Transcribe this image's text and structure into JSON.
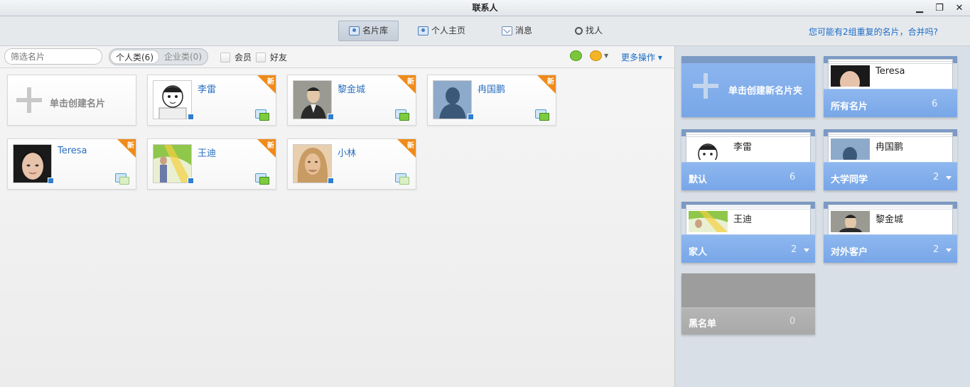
{
  "window": {
    "title": "联系人",
    "minimize": "▁",
    "restore": "❐",
    "close": "✕"
  },
  "nav": {
    "tabs": [
      {
        "label": "名片库",
        "icon": "card-library-icon",
        "active": true
      },
      {
        "label": "个人主页",
        "icon": "profile-icon",
        "active": false
      },
      {
        "label": "消息",
        "icon": "mail-icon",
        "active": false
      },
      {
        "label": "找人",
        "icon": "search-icon",
        "active": false
      }
    ],
    "merge_prompt": "您可能有2组重复的名片，合并吗?"
  },
  "toolbar": {
    "filter_placeholder": "筛选名片",
    "segments": [
      {
        "label": "个人类(6)",
        "selected": true
      },
      {
        "label": "企业类(0)",
        "selected": false
      }
    ],
    "checkbox_member": "会员",
    "checkbox_friend": "好友",
    "more_actions": "更多操作 ▾"
  },
  "cards": {
    "create_label": "单击创建名片",
    "new_badge": "新",
    "items": [
      {
        "name": "李雷",
        "avatar": "cartoon-avatar",
        "new": true,
        "chat_active": true
      },
      {
        "name": "黎金城",
        "avatar": "photo-man",
        "new": true,
        "chat_active": true
      },
      {
        "name": "冉国鹏",
        "avatar": "default-silhouette",
        "new": true,
        "chat_active": true
      },
      {
        "name": "Teresa",
        "avatar": "photo-woman",
        "new": true,
        "chat_active": false
      },
      {
        "name": "王迪",
        "avatar": "photo-colorful",
        "new": true,
        "chat_active": true
      },
      {
        "name": "小林",
        "avatar": "photo-longhair",
        "new": true,
        "chat_active": false
      }
    ]
  },
  "folders": {
    "create_label": "单击创建新名片夹",
    "items": [
      {
        "name": "所有名片",
        "count": "6",
        "preview_name": "Teresa"
      },
      {
        "name": "默认",
        "count": "6",
        "preview_name": "李雷"
      },
      {
        "name": "大学同学",
        "count": "2",
        "preview_name": "冉国鹏"
      },
      {
        "name": "家人",
        "count": "2",
        "preview_name": "王迪"
      },
      {
        "name": "对外客户",
        "count": "2",
        "preview_name": "黎金城"
      },
      {
        "name": "黑名单",
        "count": "0",
        "preview_name": ""
      }
    ]
  },
  "colors": {
    "accent_link": "#1a6cc7",
    "new_badge": "#ef8b1b",
    "folder_blue": "#78a6e7",
    "blacklist_gray": "#9d9d9d"
  }
}
